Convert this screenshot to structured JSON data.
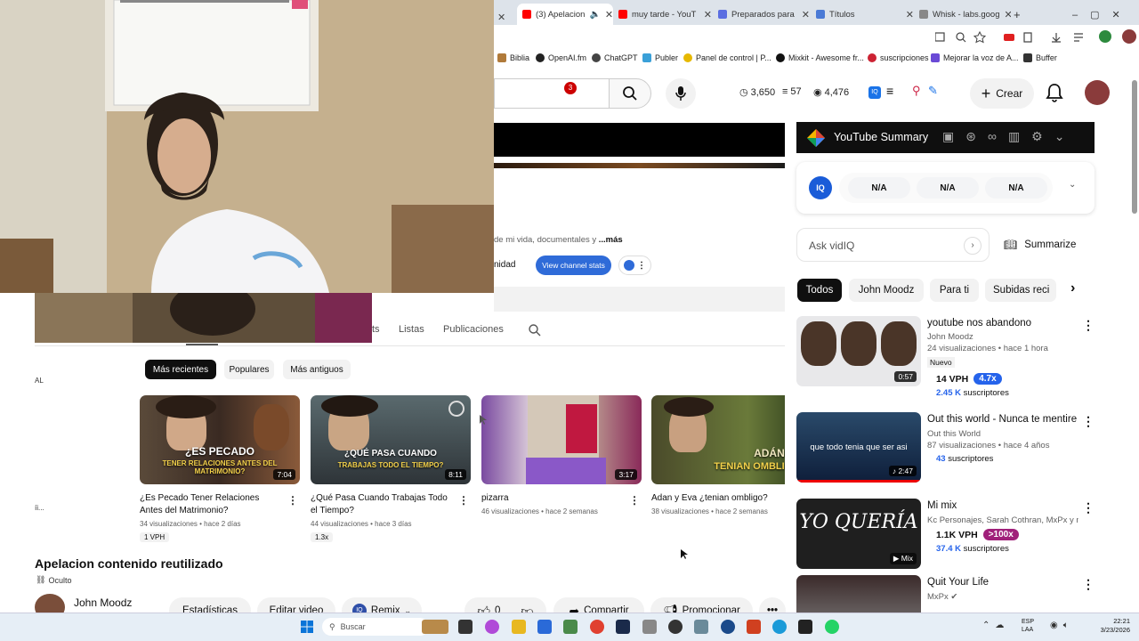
{
  "browser": {
    "tabs": [
      {
        "label": "(3) Apelacion",
        "active": true,
        "color": "#ff0000"
      },
      {
        "label": "muy tarde - YouT",
        "color": "#ff0000"
      },
      {
        "label": "Preparados para",
        "color": "#5b6ee1"
      },
      {
        "label": "Títulos",
        "color": "#4a7ad6"
      },
      {
        "label": "Whisk - labs.goog",
        "color": "#888888"
      }
    ],
    "new_tab": "+",
    "bookmarks": [
      "Biblia",
      "OpenAI.fm",
      "ChatGPT",
      "Publer",
      "Panel de control | P...",
      "Mixkit - Awesome fr...",
      "suscripciones",
      "Mejorar la voz de A...",
      "Buffer"
    ]
  },
  "yt_header": {
    "stats": {
      "views": "3,650",
      "videos": "57",
      "watch": "4,476"
    },
    "create_label": "Crear",
    "notifications": "3"
  },
  "channel": {
    "description": "de mi vida, documentales y",
    "more": "...más",
    "community_label": "nidad",
    "stats_button": "View channel stats",
    "tabs": [
      {
        "label": "ts"
      },
      {
        "label": "Listas"
      },
      {
        "label": "Publicaciones"
      }
    ],
    "chips": [
      {
        "label": "Más recientes",
        "active": true
      },
      {
        "label": "Populares"
      },
      {
        "label": "Más antiguos"
      }
    ],
    "side_label_top": "AL",
    "side_label_bottom": "íi..."
  },
  "videos": [
    {
      "title": "¿Es Pecado Tener Relaciones Antes del Matrimonio?",
      "meta": "34 visualizaciones • hace 2 días",
      "badge": "1 VPH",
      "duration": "7:04",
      "thumb_text": "¿ES PECADO",
      "thumb_sub": "TENER RELACIONES ANTES DEL MATRIMONIO?"
    },
    {
      "title": "¿Qué Pasa Cuando Trabajas Todo el Tiempo?",
      "meta": "44 visualizaciones • hace 3 días",
      "badge": "1.3x",
      "duration": "8:11",
      "thumb_text": "¿QUÉ PASA CUANDO",
      "thumb_sub": "TRABAJAS TODO EL TIEMPO?"
    },
    {
      "title": "pizarra",
      "meta": "46 visualizaciones • hace 2 semanas",
      "badge": "",
      "duration": "3:17",
      "thumb_text": "",
      "thumb_sub": ""
    },
    {
      "title": "Adan y Eva ¿tenian ombligo?",
      "meta": "38 visualizaciones • hace 2 semanas",
      "badge": "",
      "duration": "",
      "thumb_text": "ADÁN Y EV",
      "thumb_sub": "TENIAN OMBLI"
    }
  ],
  "current_video": {
    "title": "Apelacion contenido reutilizado",
    "visibility": "Oculto",
    "channel_name": "John Moodz",
    "buttons": {
      "stats": "Estadísticas",
      "edit": "Editar video",
      "remix": "Remix",
      "likes": "0",
      "share": "Compartir",
      "promote": "Promocionar"
    }
  },
  "sidebar": {
    "summary_title": "YouTube Summary",
    "na_values": [
      "N/A",
      "N/A",
      "N/A"
    ],
    "ask_placeholder": "Ask vidIQ",
    "summarize_label": "Summarize",
    "filter_chips": [
      {
        "label": "Todos",
        "active": true
      },
      {
        "label": "John Moodz"
      },
      {
        "label": "Para ti"
      },
      {
        "label": "Subidas reci"
      }
    ],
    "recommendations": [
      {
        "title": "youtube nos abandono",
        "channel": "John Moodz",
        "meta": "24 visualizaciones • hace 1 hora",
        "tag": "Nuevo",
        "vph": "14 VPH",
        "mult": "4.7x",
        "subs_num": "2.45 K",
        "subs_label": "suscriptores",
        "duration": "0:57"
      },
      {
        "title": "Out this world - Nunca te mentire",
        "channel": "Out this World",
        "meta": "87 visualizaciones • hace 4 años",
        "tag": "",
        "vph": "",
        "mult": "",
        "subs_num": "43",
        "subs_label": "suscriptores",
        "duration": "2:47",
        "thumb_caption": "que todo tenia que ser asi"
      },
      {
        "title": "Mi mix",
        "channel": "Kc Personajes, Sarah Cothran, MxPx y m...",
        "meta": "",
        "tag": "",
        "vph": "1.1K VPH",
        "mult": ">100x",
        "subs_num": "37.4 K",
        "subs_label": "suscriptores",
        "duration": "Mix",
        "thumb_caption": "YO QUERÍA"
      },
      {
        "title": "Quit Your Life",
        "channel": "MxPx",
        "meta": "",
        "tag": "",
        "vph": "",
        "mult": "",
        "subs_num": "",
        "subs_label": "",
        "duration": ""
      }
    ]
  },
  "taskbar": {
    "search_label": "Buscar",
    "lang": "ESP",
    "lang2": "LAA",
    "time": "22:21",
    "date": "3/23/2026"
  }
}
